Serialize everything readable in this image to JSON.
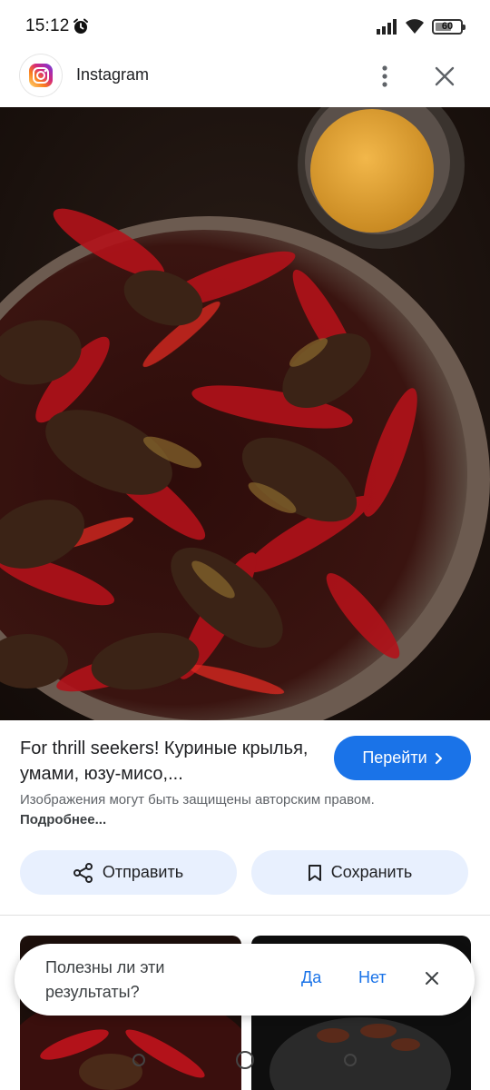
{
  "status_bar": {
    "time": "15:12",
    "battery": "60",
    "icons": [
      "alarm-icon",
      "signal-icon",
      "wifi-icon",
      "battery-icon"
    ]
  },
  "header": {
    "app_name": "Instagram",
    "icons": [
      "instagram-logo",
      "more-vert-icon",
      "close-icon"
    ]
  },
  "result": {
    "title": "For thrill seekers! Куриные крылья, умами, юзу-мисо,...",
    "goto_label": "Перейти",
    "copyright_text": "Изображения могут быть защищены авторским правом.",
    "more_link": "Подробнее..."
  },
  "actions": {
    "share_label": "Отправить",
    "save_label": "Сохранить"
  },
  "feedback": {
    "question": "Полезны ли эти результаты?",
    "yes": "Да",
    "no": "Нет"
  },
  "colors": {
    "accent": "#1a73e8",
    "pill_bg": "#e8f0fe",
    "text_primary": "#202124",
    "text_secondary": "#5f6368"
  }
}
